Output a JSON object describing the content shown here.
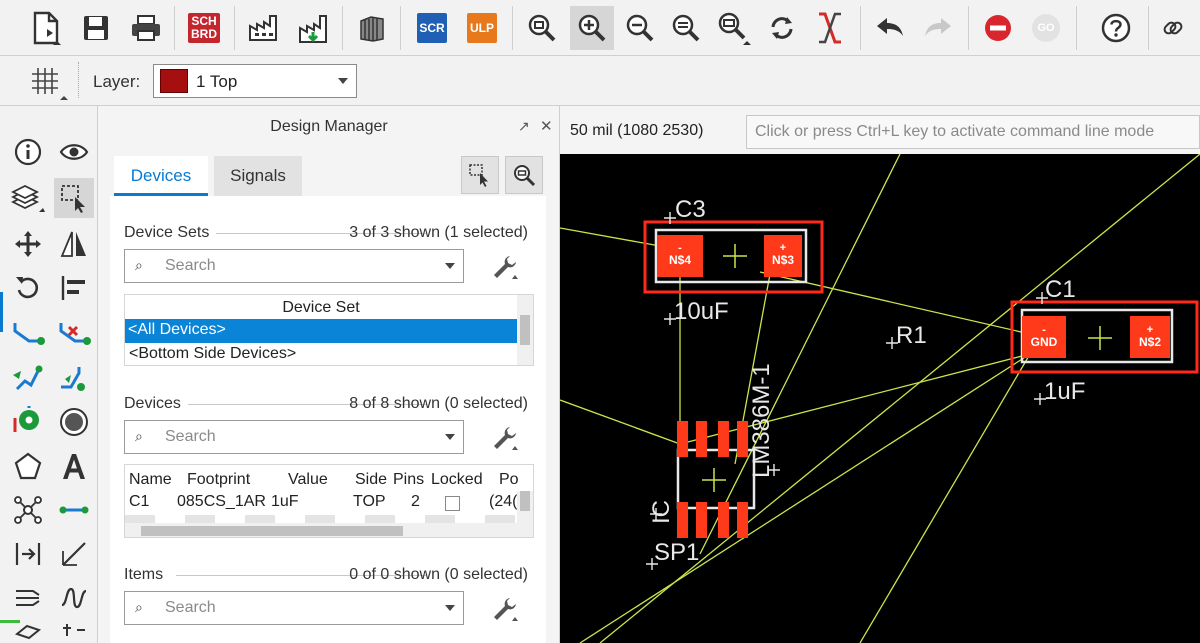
{
  "toolbar": {
    "sch_brd_label": "SCH\nBRD",
    "scr_label": "SCR",
    "ulp_label": "ULP",
    "go_label": "GO",
    "sch_brd_line1": "SCH",
    "sch_brd_line2": "BRD"
  },
  "layerbar": {
    "layer_label": "Layer:",
    "layer_value": "1 Top",
    "layer_color": "#a50f0f"
  },
  "design_manager": {
    "title": "Design Manager",
    "tabs": [
      {
        "label": "Devices",
        "active": true
      },
      {
        "label": "Signals",
        "active": false
      }
    ],
    "device_sets": {
      "label": "Device Sets",
      "count": "3 of 3 shown (1 selected)",
      "search_placeholder": "Search",
      "column": "Device Set",
      "rows": [
        "<All Devices>",
        "<Bottom Side Devices>"
      ]
    },
    "devices": {
      "label": "Devices",
      "count": "8 of 8 shown (0 selected)",
      "search_placeholder": "Search",
      "columns": [
        "Name",
        "Footprint",
        "Value",
        "Side",
        "Pins",
        "Locked",
        "Po"
      ],
      "row": {
        "name": "C1",
        "footprint": "085CS_1AR",
        "value": "1uF",
        "side": "TOP",
        "pins": "2",
        "position": "(24("
      }
    },
    "items": {
      "label": "Items",
      "count": "0 of 0 shown (0 selected)",
      "search_placeholder": "Search"
    }
  },
  "canvas": {
    "grid_info": "50 mil (1080 2530)",
    "command_placeholder": "Click or press Ctrl+L key to activate command line mode",
    "components": {
      "c3_name": "C3",
      "c3_value": "10uF",
      "c3_pad_left_sign": "-",
      "c3_pad_left": "N$4",
      "c3_pad_right_sign": "+",
      "c3_pad_right": "N$3",
      "c1_name": "C1",
      "c1_value": "1uF",
      "c1_pad_left_sign": "-",
      "c1_pad_left": "GND",
      "c1_pad_right_sign": "+",
      "c1_pad_right": "N$2",
      "r1_name": "R1",
      "ic_value": "LM386M-1",
      "ic_name": "IC",
      "sp1_name": "SP1"
    }
  },
  "colors": {
    "accent": "#0a7ad1",
    "selection": "#0a84d6",
    "pad": "#ff3a1a",
    "airwire": "#c8e64a",
    "highlight": "#ff2a1a"
  }
}
